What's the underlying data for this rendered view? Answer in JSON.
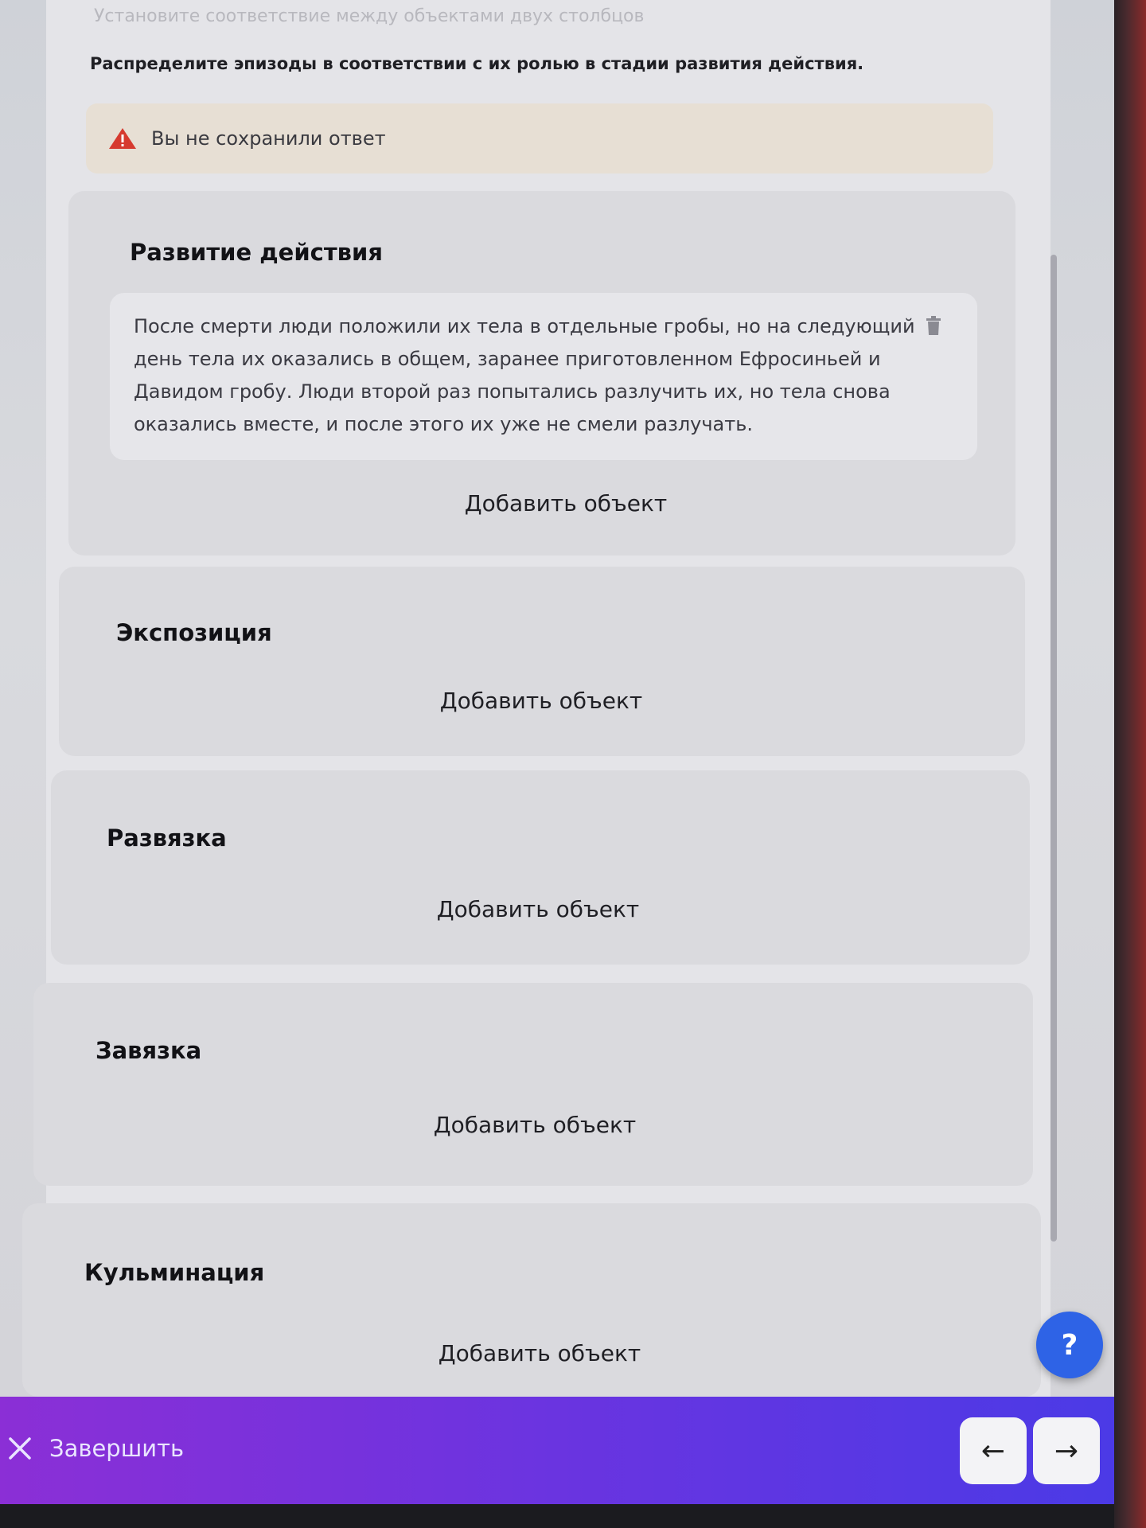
{
  "header": {
    "instruction_muted": "Установите соответствие между объектами двух столбцов",
    "instruction": "Распределите эпизоды в соответствии с их ролью в стадии развития действия."
  },
  "warning": {
    "text": "Вы не сохранили ответ",
    "icon": "warning-triangle-icon",
    "color": "#d63a2f"
  },
  "groups": [
    {
      "title": "Развитие действия",
      "items": [
        "После смерти люди положили их тела в отдельные гробы, но на следующий день тела их оказались в общем, заранее приготовленном Ефросиньей и Давидом гробу. Люди второй раз попытались разлучить их, но тела снова оказались вместе, и после этого их уже не смели разлучать."
      ],
      "add_label": "Добавить объект"
    },
    {
      "title": "Экспозиция",
      "items": [],
      "add_label": "Добавить объект"
    },
    {
      "title": "Развязка",
      "items": [],
      "add_label": "Добавить объект"
    },
    {
      "title": "Завязка",
      "items": [],
      "add_label": "Добавить объект"
    },
    {
      "title": "Кульминация",
      "items": [],
      "add_label": "Добавить объект"
    }
  ],
  "help": {
    "label": "?",
    "color": "#2e63e6"
  },
  "footer": {
    "finish_label": "Завершить",
    "finish_icon": "close-icon",
    "prev_label": "←",
    "next_label": "→"
  }
}
